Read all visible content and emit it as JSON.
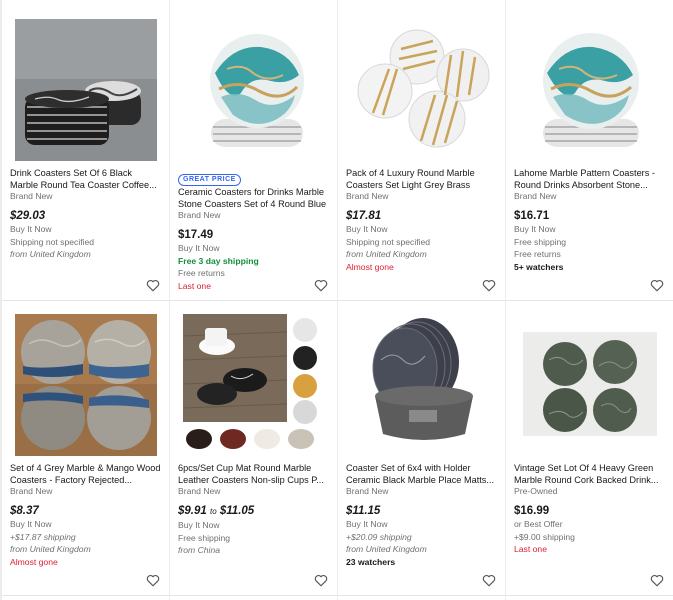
{
  "listings": [
    {
      "title": "Drink Coasters Set Of 6 Black Marble Round Tea Coaster Coffee...",
      "condition": "Brand New",
      "price": "$29.03",
      "buy_format": "Buy It Now",
      "shipping": "Shipping not specified",
      "location": "from United Kingdom",
      "image_icon": "black-marble-coaster-stack-image"
    },
    {
      "badge": "GREAT PRICE",
      "title": "Ceramic Coasters for Drinks Marble Stone Coasters Set of 4 Round Blue",
      "condition": "Brand New",
      "price": "$17.49",
      "buy_format": "Buy It Now",
      "shipping": "Free 3 day shipping",
      "returns": "Free returns",
      "urgency": "Last one",
      "image_icon": "teal-gold-marble-coaster-image"
    },
    {
      "title": "Pack of 4 Luxury Round Marble Coasters Set Light Grey Brass Drin...",
      "condition": "Brand New",
      "price": "$17.81",
      "buy_format": "Buy It Now",
      "shipping": "Shipping not specified",
      "location": "from United Kingdom",
      "urgency": "Almost gone",
      "image_icon": "white-marble-brass-coaster-image"
    },
    {
      "title": "Lahome Marble Pattern Coasters - Round Drinks Absorbent Stone...",
      "condition": "Brand New",
      "price": "$16.71",
      "buy_format": "Buy It Now",
      "shipping": "Free shipping",
      "returns": "Free returns",
      "watchers": "5+ watchers",
      "image_icon": "teal-gold-marble-coaster-image"
    },
    {
      "title": "Set of 4 Grey Marble & Mango Wood Coasters - Factory Rejected...",
      "condition": "Brand New",
      "price": "$8.37",
      "buy_format": "Buy It Now",
      "shipping": "+$17.87 shipping",
      "location": "from United Kingdom",
      "urgency": "Almost gone",
      "image_icon": "marble-mango-wood-coaster-image"
    },
    {
      "title": "6pcs/Set Cup Mat Round Marble Leather Coasters Non-slip Cups P...",
      "condition": "Brand New",
      "price_low": "$9.91",
      "price_to": "to",
      "price_high": "$11.05",
      "buy_format": "Buy It Now",
      "shipping": "Free shipping",
      "location": "from China",
      "image_icon": "leather-coaster-variants-image"
    },
    {
      "title": "Coaster Set of 6x4 with Holder Ceramic Black Marble Place Matts...",
      "condition": "Brand New",
      "price": "$11.15",
      "buy_format": "Buy It Now",
      "shipping": "+$20.09 shipping",
      "location": "from United Kingdom",
      "watchers": "23 watchers",
      "image_icon": "black-marble-coaster-holder-image"
    },
    {
      "title": "Vintage Set Lot Of 4 Heavy Green Marble Round Cork Backed Drink...",
      "condition": "Pre-Owned",
      "price": "$16.99",
      "buy_format": "or Best Offer",
      "shipping": "+$9.00 shipping",
      "urgency": "Last one",
      "image_icon": "green-marble-coaster-image"
    }
  ],
  "colors": {
    "badge_blue": "#3665f3",
    "free_shipping_green": "#118d3c",
    "urgency_red": "#dd1e31",
    "secondary_text": "#707070"
  }
}
